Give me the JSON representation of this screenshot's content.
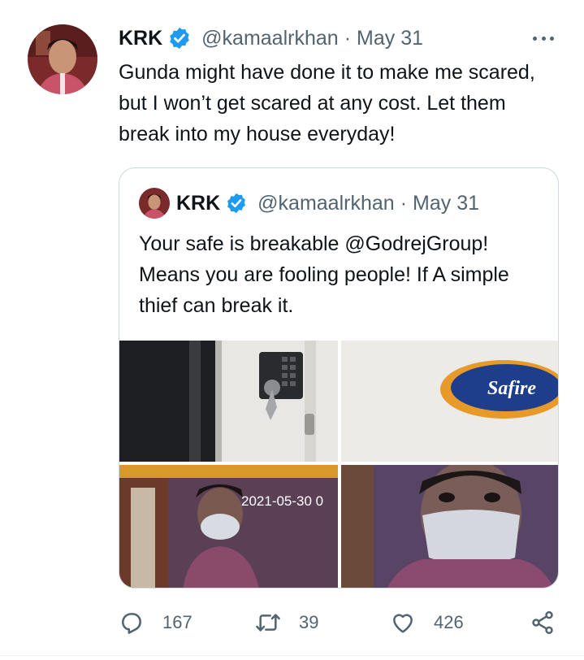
{
  "colors": {
    "verified": "#1d9bf0",
    "secondary_text": "#536471",
    "border": "#cfd9de"
  },
  "tweet": {
    "author_name": "KRK",
    "handle": "@kamaalrkhan",
    "separator": "·",
    "date": "May 31",
    "text": "Gunda might have done it to make me scared, but I won’t get scared at any cost. Let them break into my house everyday!",
    "more_icon": "more-horizontal-icon"
  },
  "quoted_tweet": {
    "author_name": "KRK",
    "handle": "@kamaalrkhan",
    "separator": "·",
    "date": "May 31",
    "text": "Your safe is breakable @GodrejGroup! Means you are fooling people! If A simple thief can break it.",
    "images": [
      {
        "name": "safe-lock-photo"
      },
      {
        "name": "safire-logo-photo",
        "text": "Safire"
      },
      {
        "name": "cctv-frame-1",
        "timestamp": "2021-05-30 0"
      },
      {
        "name": "cctv-frame-2"
      }
    ]
  },
  "actions": {
    "reply": {
      "icon": "reply-icon",
      "count": "167"
    },
    "retweet": {
      "icon": "retweet-icon",
      "count": "39"
    },
    "like": {
      "icon": "heart-icon",
      "count": "426"
    },
    "share": {
      "icon": "share-icon"
    }
  }
}
